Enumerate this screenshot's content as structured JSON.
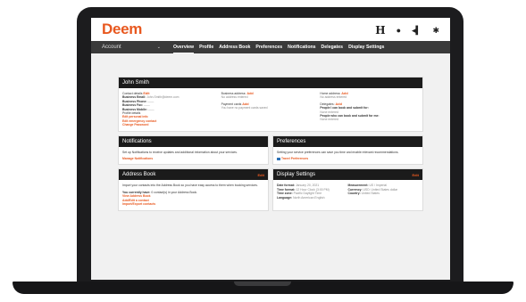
{
  "brand": {
    "logo": "Deem",
    "accent": "#e8581f"
  },
  "topbar": {
    "icons": [
      "help-icon",
      "star-icon",
      "back-icon",
      "gear-icon"
    ],
    "h_glyph": "H",
    "star_glyph": "●",
    "back_glyph": "◂▍",
    "gear_glyph": "✱"
  },
  "nav": {
    "account_label": "Account",
    "chevron": "⌄",
    "tabs": [
      "Overview",
      "Profile",
      "Address Book",
      "Preferences",
      "Notifications",
      "Delegates",
      "Display Settings"
    ]
  },
  "profile": {
    "title": "John Smith",
    "contact_details_label": "Contact details",
    "edit": "Edit",
    "add": "Add",
    "business_email": "Business Email:",
    "business_email_value": "John.Smith@deem.com",
    "business_phone": "Business Phone:",
    "business_phone_value": "——",
    "business_fax": "Business Fax:",
    "business_fax_value": "——",
    "business_mobile": "Business Mobile:",
    "business_mobile_value": "——",
    "profile_details": "Profile details",
    "edit_personal": "Edit personal info",
    "edit_emergency": "Edit emergency contact",
    "change_password": "Change Password",
    "business_address_label": "Business address:",
    "no_address": "No address entered",
    "payment_cards_label": "Payment cards",
    "no_cards": "You have no payment cards saved",
    "home_address_label": "Home address:",
    "home_no_address": "No address entered",
    "delegates_label": "Delegates:",
    "people_i_book": "People I can book and submit for:",
    "none_entered": "None entered",
    "people_book_me": "People who can book and submit for me:",
    "none_entered2": "None entered"
  },
  "notifications": {
    "title": "Notifications",
    "text": "Set up Notifications to receive updates and additional information about your services.",
    "link": "Manage Notifications"
  },
  "preferences": {
    "title": "Preferences",
    "text": "Setting your service preferences can save you time and enable relevant recommendations.",
    "link": "Travel Preferences"
  },
  "address_book": {
    "title": "Address Book",
    "edit": "Edit",
    "text": "Import your contacts into the Address Book so you have easy access to them when booking services.",
    "count_prefix": "You currently have:",
    "count_text": "0 contact(s) in your Address Book.",
    "link1": "View Address Book",
    "link2": "Add/Edit a contact",
    "link3": "Import/Export contacts"
  },
  "display_settings": {
    "title": "Display Settings",
    "edit": "Edit",
    "date_format_label": "Date format:",
    "date_format_value": "January 20, 2021",
    "time_format_label": "Time format:",
    "time_format_value": "12 Hour Clock (3:00 PM)",
    "time_zone_label": "Time zone:",
    "time_zone_value": "Pacific Daylight Time",
    "language_label": "Language:",
    "language_value": "North American English",
    "measurement_label": "Measurement:",
    "measurement_value": "US / Imperial",
    "currency_label": "Currency:",
    "currency_value": "USD: United States dollar",
    "country_label": "Country:",
    "country_value": "United States"
  }
}
